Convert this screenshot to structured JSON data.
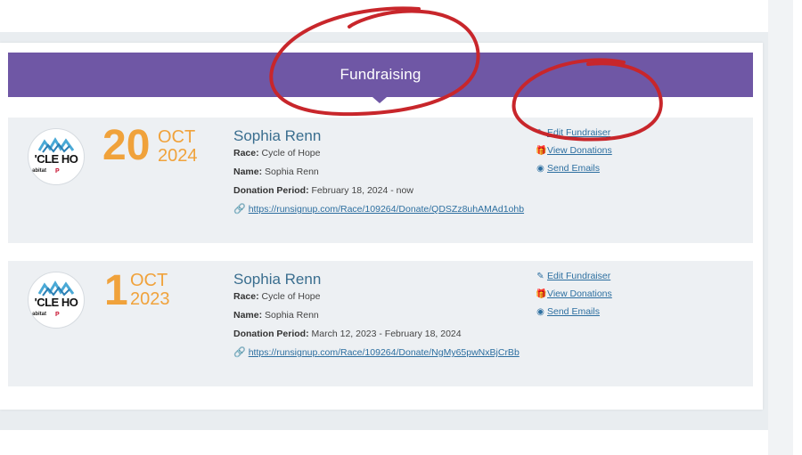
{
  "header": {
    "title": "Fundraising"
  },
  "fundraisers": [
    {
      "day": "20",
      "month": "OCT",
      "year": "2024",
      "name": "Sophia Renn",
      "race_label": "Race:",
      "race": "Cycle of Hope",
      "name_label": "Name:",
      "name_value": "Sophia Renn",
      "period_label": "Donation Period:",
      "period": "February 18, 2024 - now",
      "url": "https://runsignup.com/Race/109264/Donate/QDSZz8uhAMAd1ohb",
      "actions": {
        "edit": "Edit Fundraiser",
        "view": "View Donations",
        "send": "Send Emails"
      },
      "logo": {
        "text": "'CLE HO",
        "sub": "abitat",
        "sub2": "P"
      }
    },
    {
      "day": "1",
      "month": "OCT",
      "year": "2023",
      "name": "Sophia Renn",
      "race_label": "Race:",
      "race": "Cycle of Hope",
      "name_label": "Name:",
      "name_value": "Sophia Renn",
      "period_label": "Donation Period:",
      "period": "March 12, 2023 - February 18, 2024",
      "url": "https://runsignup.com/Race/109264/Donate/NgMy65pwNxBjCrBb",
      "actions": {
        "edit": "Edit Fundraiser",
        "view": "View Donations",
        "send": "Send Emails"
      },
      "logo": {
        "text": "'CLE HO",
        "sub": "abitat",
        "sub2": "P"
      }
    }
  ],
  "colors": {
    "header_bg": "#6f57a5",
    "date_accent": "#f0a23b",
    "link": "#2d6fa0",
    "annotation": "#c8262b"
  }
}
